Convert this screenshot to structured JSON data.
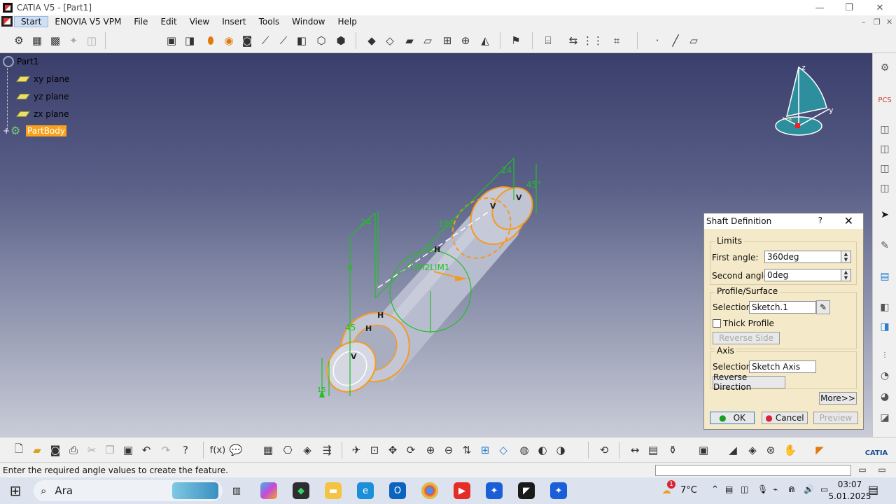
{
  "window": {
    "title": "CATIA V5 - [Part1]",
    "min": "—",
    "max": "❐",
    "close": "✕"
  },
  "menu": {
    "items": [
      "Start",
      "ENOVIA V5 VPM",
      "File",
      "Edit",
      "View",
      "Insert",
      "Tools",
      "Window",
      "Help"
    ]
  },
  "mdi": {
    "min": "–",
    "restore": "❐",
    "close": "✕"
  },
  "tree": {
    "root": "Part1",
    "planes": [
      "xy plane",
      "yz plane",
      "zx plane"
    ],
    "body": "PartBody",
    "expand": "+"
  },
  "compass": {
    "z": "z",
    "y": "y",
    "x": "x"
  },
  "model": {
    "labels": {
      "limits": "LIM2LIM1",
      "dim_24_top": "24",
      "dim_45_top": "45°",
      "dim_24_left": "24",
      "dim_102": "102",
      "dim_9": "9",
      "dim_0": "0",
      "dim_45_low": "45",
      "dim_15": "15",
      "h1": "H",
      "h2": "H",
      "h3": "H",
      "v1": "V",
      "v2": "V",
      "v3": "V"
    }
  },
  "dialog": {
    "title": "Shaft Definition",
    "help": "?",
    "close": "✕",
    "limits_group": "Limits",
    "first_angle_label": "First angle:",
    "first_angle_value": "360deg",
    "second_angle_label": "Second angle:",
    "second_angle_value": "0deg",
    "profile_group": "Profile/Surface",
    "profile_selection_label": "Selection:",
    "profile_selection_value": "Sketch.1",
    "thick_profile": "Thick Profile",
    "reverse_side": "Reverse Side",
    "axis_group": "Axis",
    "axis_selection_label": "Selection:",
    "axis_selection_value": "Sketch Axis",
    "reverse_direction": "Reverse Direction",
    "more": "More>>",
    "ok": "OK",
    "cancel": "Cancel",
    "preview": "Preview"
  },
  "status": {
    "message": "Enter the required angle values to create the feature."
  },
  "taskbar": {
    "search": "Ara",
    "weather": "7°C",
    "weather_badge": "1",
    "time": "03:07",
    "date": "5.01.2025"
  },
  "catia_logo": "CATIA",
  "colors": {
    "accent": "#f7a21a",
    "sketch_green": "#22c022",
    "edge_orange": "#f59a1f",
    "shaft_fill": "#b8bccf"
  }
}
